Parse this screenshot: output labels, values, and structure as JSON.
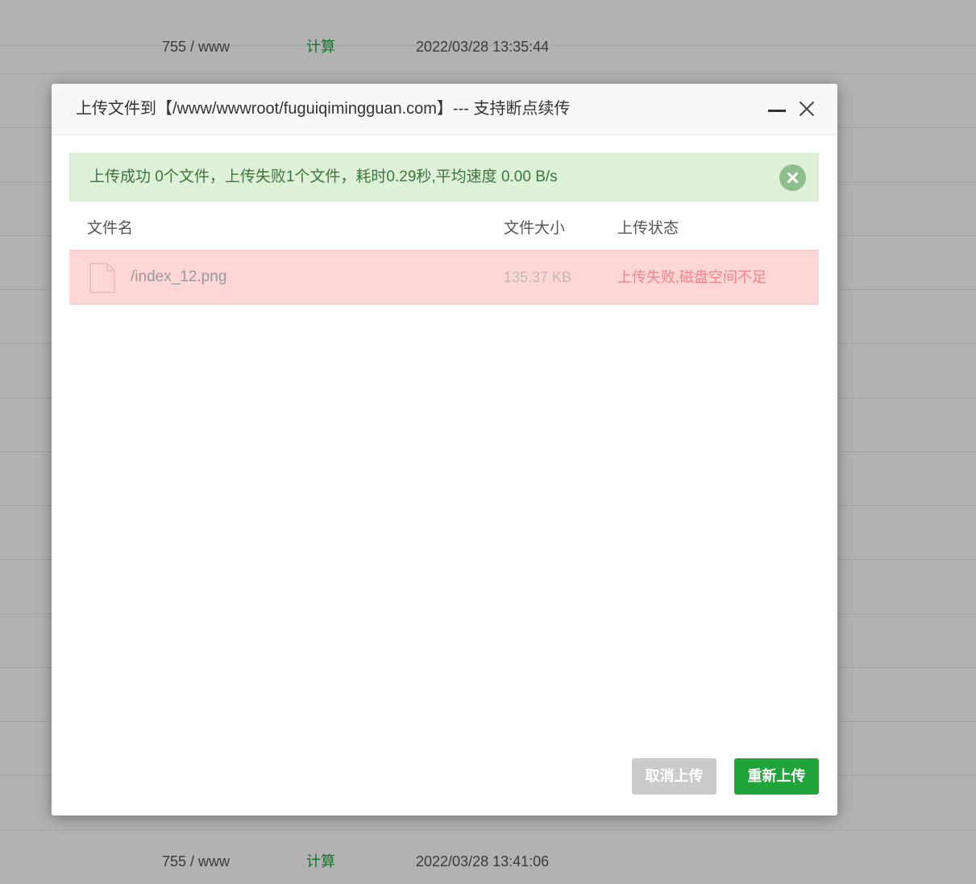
{
  "background_rows": [
    {
      "perm": "",
      "calc": "",
      "time": ""
    },
    {
      "perm": "755 / www",
      "calc": "计算",
      "time": "2022/03/28 13:35:44"
    },
    {
      "perm": "",
      "calc": "",
      "time": ""
    },
    {
      "perm": "",
      "calc": "",
      "time": ""
    },
    {
      "perm": "",
      "calc": "",
      "time": ""
    },
    {
      "perm": "",
      "calc": "",
      "time": ""
    },
    {
      "perm": "",
      "calc": "",
      "time": ""
    },
    {
      "perm": "",
      "calc": "",
      "time": ""
    },
    {
      "perm": "",
      "calc": "",
      "time": ""
    },
    {
      "perm": "",
      "calc": "",
      "time": ""
    },
    {
      "perm": "",
      "calc": "",
      "time": ""
    },
    {
      "perm": "",
      "calc": "",
      "time": ""
    },
    {
      "perm": "",
      "calc": "",
      "time": ""
    },
    {
      "perm": "",
      "calc": "",
      "time": ""
    },
    {
      "perm": "",
      "calc": "",
      "time": ""
    },
    {
      "perm": "755 / www",
      "calc": "计算",
      "time": "2022/03/28 13:41:06"
    }
  ],
  "dialog": {
    "title": "上传文件到【/www/wwwroot/fuguiqimingguan.com】--- 支持断点续传",
    "minimize_icon": "minimize-icon",
    "close_icon": "close-icon"
  },
  "alert": {
    "text": "上传成功 0个文件，上传失败1个文件，耗时0.29秒,平均速度 0.00 B/s",
    "close_icon": "close-circle-icon",
    "color": "#3c763d"
  },
  "table": {
    "headers": {
      "name": "文件名",
      "size": "文件大小",
      "status": "上传状态"
    },
    "rows": [
      {
        "icon": "file-icon",
        "name": "/index_12.png",
        "size": "135.37 KB",
        "status": "上传失败,磁盘空间不足"
      }
    ]
  },
  "buttons": {
    "cancel_label": "取消上传",
    "reupload_label": "重新上传"
  },
  "colors": {
    "accent": "#20a53a",
    "error_row": "#ffd6d6",
    "error_text": "#f08585",
    "success_bg": "#dff0d8"
  }
}
